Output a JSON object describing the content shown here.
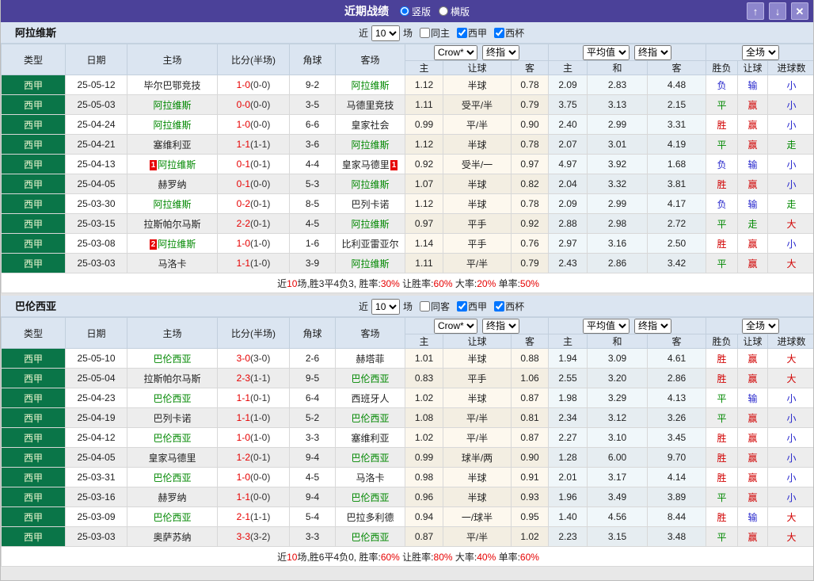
{
  "titlebar": {
    "title": "近期战绩",
    "view_options": [
      {
        "label": "竖版",
        "selected": true
      },
      {
        "label": "横版",
        "selected": false
      }
    ],
    "buttons": {
      "up": "↑",
      "down": "↓",
      "close": "✕"
    }
  },
  "table": {
    "headers": {
      "type": "类型",
      "date": "日期",
      "home": "主场",
      "score": "比分(半场)",
      "corner": "角球",
      "away": "客场",
      "asia_home": "主",
      "asia_line": "让球",
      "asia_away": "客",
      "eu_home": "主",
      "eu_draw": "和",
      "eu_away": "客",
      "result": "胜负",
      "handicap": "让球",
      "goals": "进球数"
    },
    "selects": {
      "company": "Crow*",
      "company_period": "终指",
      "average": "平均值",
      "average_period": "终指",
      "scope": "全场"
    }
  },
  "sections": [
    {
      "team": "阿拉维斯",
      "filters": {
        "near": "近",
        "count": "10",
        "games": "场",
        "same": "同主",
        "same_checked": false,
        "league": "西甲",
        "league_checked": true,
        "cup": "西杯",
        "cup_checked": true
      },
      "rows": [
        {
          "league": "西甲",
          "date": "25-05-12",
          "home": "毕尔巴鄂竞技",
          "home_badge": "",
          "score": "1-0",
          "half": "(0-0)",
          "corners": "9-2",
          "away": "阿拉维斯",
          "away_badge": "",
          "asia": [
            "1.12",
            "半球",
            "0.78"
          ],
          "europe": [
            "2.09",
            "2.83",
            "4.48"
          ],
          "result": "负",
          "asia_result": "输",
          "goal_result": "小"
        },
        {
          "league": "西甲",
          "date": "25-05-03",
          "home": "阿拉维斯",
          "home_badge": "",
          "score": "0-0",
          "half": "(0-0)",
          "corners": "3-5",
          "away": "马德里竞技",
          "away_badge": "",
          "asia": [
            "1.11",
            "受平/半",
            "0.79"
          ],
          "europe": [
            "3.75",
            "3.13",
            "2.15"
          ],
          "result": "平",
          "asia_result": "赢",
          "goal_result": "小"
        },
        {
          "league": "西甲",
          "date": "25-04-24",
          "home": "阿拉维斯",
          "home_badge": "",
          "score": "1-0",
          "half": "(0-0)",
          "corners": "6-6",
          "away": "皇家社会",
          "away_badge": "",
          "asia": [
            "0.99",
            "平/半",
            "0.90"
          ],
          "europe": [
            "2.40",
            "2.99",
            "3.31"
          ],
          "result": "胜",
          "asia_result": "赢",
          "goal_result": "小"
        },
        {
          "league": "西甲",
          "date": "25-04-21",
          "home": "塞维利亚",
          "home_badge": "",
          "score": "1-1",
          "half": "(1-1)",
          "corners": "3-6",
          "away": "阿拉维斯",
          "away_badge": "",
          "asia": [
            "1.12",
            "半球",
            "0.78"
          ],
          "europe": [
            "2.07",
            "3.01",
            "4.19"
          ],
          "result": "平",
          "asia_result": "赢",
          "goal_result": "走"
        },
        {
          "league": "西甲",
          "date": "25-04-13",
          "home": "阿拉维斯",
          "home_badge": "1",
          "score": "0-1",
          "half": "(0-1)",
          "corners": "4-4",
          "away": "皇家马德里",
          "away_badge": "1",
          "asia": [
            "0.92",
            "受半/一",
            "0.97"
          ],
          "europe": [
            "4.97",
            "3.92",
            "1.68"
          ],
          "result": "负",
          "asia_result": "输",
          "goal_result": "小"
        },
        {
          "league": "西甲",
          "date": "25-04-05",
          "home": "赫罗纳",
          "home_badge": "",
          "score": "0-1",
          "half": "(0-0)",
          "corners": "5-3",
          "away": "阿拉维斯",
          "away_badge": "",
          "asia": [
            "1.07",
            "半球",
            "0.82"
          ],
          "europe": [
            "2.04",
            "3.32",
            "3.81"
          ],
          "result": "胜",
          "asia_result": "赢",
          "goal_result": "小"
        },
        {
          "league": "西甲",
          "date": "25-03-30",
          "home": "阿拉维斯",
          "home_badge": "",
          "score": "0-2",
          "half": "(0-1)",
          "corners": "8-5",
          "away": "巴列卡诺",
          "away_badge": "",
          "asia": [
            "1.12",
            "半球",
            "0.78"
          ],
          "europe": [
            "2.09",
            "2.99",
            "4.17"
          ],
          "result": "负",
          "asia_result": "输",
          "goal_result": "走"
        },
        {
          "league": "西甲",
          "date": "25-03-15",
          "home": "拉斯帕尔马斯",
          "home_badge": "",
          "score": "2-2",
          "half": "(0-1)",
          "corners": "4-5",
          "away": "阿拉维斯",
          "away_badge": "",
          "asia": [
            "0.97",
            "平手",
            "0.92"
          ],
          "europe": [
            "2.88",
            "2.98",
            "2.72"
          ],
          "result": "平",
          "asia_result": "走",
          "goal_result": "大"
        },
        {
          "league": "西甲",
          "date": "25-03-08",
          "home": "阿拉维斯",
          "home_badge": "2",
          "score": "1-0",
          "half": "(1-0)",
          "corners": "1-6",
          "away": "比利亚雷亚尔",
          "away_badge": "",
          "asia": [
            "1.14",
            "平手",
            "0.76"
          ],
          "europe": [
            "2.97",
            "3.16",
            "2.50"
          ],
          "result": "胜",
          "asia_result": "赢",
          "goal_result": "小"
        },
        {
          "league": "西甲",
          "date": "25-03-03",
          "home": "马洛卡",
          "home_badge": "",
          "score": "1-1",
          "half": "(1-0)",
          "corners": "3-9",
          "away": "阿拉维斯",
          "away_badge": "",
          "asia": [
            "1.11",
            "平/半",
            "0.79"
          ],
          "europe": [
            "2.43",
            "2.86",
            "3.42"
          ],
          "result": "平",
          "asia_result": "赢",
          "goal_result": "大"
        }
      ],
      "summary_parts": [
        {
          "t": "近"
        },
        {
          "t": "10",
          "r": 1
        },
        {
          "t": "场,胜3平4负3, 胜率:"
        },
        {
          "t": "30%",
          "r": 1
        },
        {
          "t": " 让胜率:"
        },
        {
          "t": "60%",
          "r": 1
        },
        {
          "t": " 大率:"
        },
        {
          "t": "20%",
          "r": 1
        },
        {
          "t": " 单率:"
        },
        {
          "t": "50%",
          "r": 1
        }
      ]
    },
    {
      "team": "巴伦西亚",
      "filters": {
        "near": "近",
        "count": "10",
        "games": "场",
        "same": "同客",
        "same_checked": false,
        "league": "西甲",
        "league_checked": true,
        "cup": "西杯",
        "cup_checked": true
      },
      "rows": [
        {
          "league": "西甲",
          "date": "25-05-10",
          "home": "巴伦西亚",
          "home_badge": "",
          "score": "3-0",
          "half": "(3-0)",
          "corners": "2-6",
          "away": "赫塔菲",
          "away_badge": "",
          "asia": [
            "1.01",
            "半球",
            "0.88"
          ],
          "europe": [
            "1.94",
            "3.09",
            "4.61"
          ],
          "result": "胜",
          "asia_result": "赢",
          "goal_result": "大"
        },
        {
          "league": "西甲",
          "date": "25-05-04",
          "home": "拉斯帕尔马斯",
          "home_badge": "",
          "score": "2-3",
          "half": "(1-1)",
          "corners": "9-5",
          "away": "巴伦西亚",
          "away_badge": "",
          "asia": [
            "0.83",
            "平手",
            "1.06"
          ],
          "europe": [
            "2.55",
            "3.20",
            "2.86"
          ],
          "result": "胜",
          "asia_result": "赢",
          "goal_result": "大"
        },
        {
          "league": "西甲",
          "date": "25-04-23",
          "home": "巴伦西亚",
          "home_badge": "",
          "score": "1-1",
          "half": "(0-1)",
          "corners": "6-4",
          "away": "西班牙人",
          "away_badge": "",
          "asia": [
            "1.02",
            "半球",
            "0.87"
          ],
          "europe": [
            "1.98",
            "3.29",
            "4.13"
          ],
          "result": "平",
          "asia_result": "输",
          "goal_result": "小"
        },
        {
          "league": "西甲",
          "date": "25-04-19",
          "home": "巴列卡诺",
          "home_badge": "",
          "score": "1-1",
          "half": "(1-0)",
          "corners": "5-2",
          "away": "巴伦西亚",
          "away_badge": "",
          "asia": [
            "1.08",
            "平/半",
            "0.81"
          ],
          "europe": [
            "2.34",
            "3.12",
            "3.26"
          ],
          "result": "平",
          "asia_result": "赢",
          "goal_result": "小"
        },
        {
          "league": "西甲",
          "date": "25-04-12",
          "home": "巴伦西亚",
          "home_badge": "",
          "score": "1-0",
          "half": "(1-0)",
          "corners": "3-3",
          "away": "塞维利亚",
          "away_badge": "",
          "asia": [
            "1.02",
            "平/半",
            "0.87"
          ],
          "europe": [
            "2.27",
            "3.10",
            "3.45"
          ],
          "result": "胜",
          "asia_result": "赢",
          "goal_result": "小"
        },
        {
          "league": "西甲",
          "date": "25-04-05",
          "home": "皇家马德里",
          "home_badge": "",
          "score": "1-2",
          "half": "(0-1)",
          "corners": "9-4",
          "away": "巴伦西亚",
          "away_badge": "",
          "asia": [
            "0.99",
            "球半/两",
            "0.90"
          ],
          "europe": [
            "1.28",
            "6.00",
            "9.70"
          ],
          "result": "胜",
          "asia_result": "赢",
          "goal_result": "小"
        },
        {
          "league": "西甲",
          "date": "25-03-31",
          "home": "巴伦西亚",
          "home_badge": "",
          "score": "1-0",
          "half": "(0-0)",
          "corners": "4-5",
          "away": "马洛卡",
          "away_badge": "",
          "asia": [
            "0.98",
            "半球",
            "0.91"
          ],
          "europe": [
            "2.01",
            "3.17",
            "4.14"
          ],
          "result": "胜",
          "asia_result": "赢",
          "goal_result": "小"
        },
        {
          "league": "西甲",
          "date": "25-03-16",
          "home": "赫罗纳",
          "home_badge": "",
          "score": "1-1",
          "half": "(0-0)",
          "corners": "9-4",
          "away": "巴伦西亚",
          "away_badge": "",
          "asia": [
            "0.96",
            "半球",
            "0.93"
          ],
          "europe": [
            "1.96",
            "3.49",
            "3.89"
          ],
          "result": "平",
          "asia_result": "赢",
          "goal_result": "小"
        },
        {
          "league": "西甲",
          "date": "25-03-09",
          "home": "巴伦西亚",
          "home_badge": "",
          "score": "2-1",
          "half": "(1-1)",
          "corners": "5-4",
          "away": "巴拉多利德",
          "away_badge": "",
          "asia": [
            "0.94",
            "一/球半",
            "0.95"
          ],
          "europe": [
            "1.40",
            "4.56",
            "8.44"
          ],
          "result": "胜",
          "asia_result": "输",
          "goal_result": "大"
        },
        {
          "league": "西甲",
          "date": "25-03-03",
          "home": "奥萨苏纳",
          "home_badge": "",
          "score": "3-3",
          "half": "(3-2)",
          "corners": "3-3",
          "away": "巴伦西亚",
          "away_badge": "",
          "asia": [
            "0.87",
            "平/半",
            "1.02"
          ],
          "europe": [
            "2.23",
            "3.15",
            "3.48"
          ],
          "result": "平",
          "asia_result": "赢",
          "goal_result": "大"
        }
      ],
      "summary_parts": [
        {
          "t": "近"
        },
        {
          "t": "10",
          "r": 1
        },
        {
          "t": "场,胜6平4负0, 胜率:"
        },
        {
          "t": "60%",
          "r": 1
        },
        {
          "t": " 让胜率:"
        },
        {
          "t": "80%",
          "r": 1
        },
        {
          "t": " 大率:"
        },
        {
          "t": "40%",
          "r": 1
        },
        {
          "t": " 单率:"
        },
        {
          "t": "60%",
          "r": 1
        }
      ]
    }
  ]
}
